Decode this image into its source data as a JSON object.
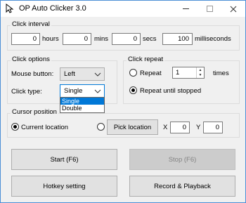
{
  "window": {
    "title": "OP Auto Clicker 3.0",
    "accent_color": "#0078d7"
  },
  "click_interval": {
    "title": "Click interval",
    "hours": {
      "value": "0",
      "label": "hours"
    },
    "mins": {
      "value": "0",
      "label": "mins"
    },
    "secs": {
      "value": "0",
      "label": "secs"
    },
    "milliseconds": {
      "value": "100",
      "label": "milliseconds"
    }
  },
  "click_options": {
    "title": "Click options",
    "mouse_button_label": "Mouse button:",
    "mouse_button_value": "Left",
    "click_type_label": "Click type:",
    "click_type_value": "Single",
    "click_type_options": [
      "Single",
      "Double"
    ]
  },
  "click_repeat": {
    "title": "Click repeat",
    "repeat_label": "Repeat",
    "repeat_value": "1",
    "times_label": "times",
    "repeat_until_stopped_label": "Repeat until stopped"
  },
  "cursor_position": {
    "title": "Cursor position",
    "current_location_label": "Current location",
    "pick_location_label": "Pick location",
    "x_label": "X",
    "x_value": "0",
    "y_label": "Y",
    "y_value": "0"
  },
  "buttons": {
    "start": "Start (F6)",
    "stop": "Stop (F6)",
    "hotkey": "Hotkey setting",
    "record": "Record & Playback"
  }
}
